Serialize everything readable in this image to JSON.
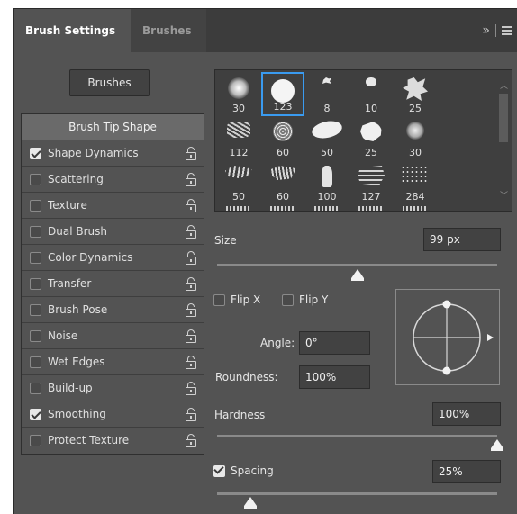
{
  "tabs": [
    {
      "label": "Brush Settings",
      "active": true
    },
    {
      "label": "Brushes",
      "active": false
    }
  ],
  "tabbar_icons": [
    "expand-icon",
    "menu-icon"
  ],
  "tabbar_expand_glyph": "»",
  "brushes_button": "Brushes",
  "list": {
    "header": "Brush Tip Shape",
    "items": [
      {
        "label": "Shape Dynamics",
        "checked": true
      },
      {
        "label": "Scattering",
        "checked": false
      },
      {
        "label": "Texture",
        "checked": false
      },
      {
        "label": "Dual Brush",
        "checked": false
      },
      {
        "label": "Color Dynamics",
        "checked": false
      },
      {
        "label": "Transfer",
        "checked": false
      },
      {
        "label": "Brush Pose",
        "checked": false
      },
      {
        "label": "Noise",
        "checked": false
      },
      {
        "label": "Wet Edges",
        "checked": false
      },
      {
        "label": "Build-up",
        "checked": false
      },
      {
        "label": "Smoothing",
        "checked": true
      },
      {
        "label": "Protect Texture",
        "checked": false
      }
    ]
  },
  "presets": [
    {
      "size": "30",
      "selected": false
    },
    {
      "size": "123",
      "selected": true
    },
    {
      "size": "8",
      "selected": false
    },
    {
      "size": "10",
      "selected": false
    },
    {
      "size": "25",
      "selected": false
    },
    {
      "size": "112",
      "selected": false
    },
    {
      "size": "60",
      "selected": false
    },
    {
      "size": "50",
      "selected": false
    },
    {
      "size": "25",
      "selected": false
    },
    {
      "size": "30",
      "selected": false
    },
    {
      "size": "50",
      "selected": false
    },
    {
      "size": "60",
      "selected": false
    },
    {
      "size": "100",
      "selected": false
    },
    {
      "size": "127",
      "selected": false
    },
    {
      "size": "284",
      "selected": false
    }
  ],
  "size": {
    "label": "Size",
    "value": "99 px",
    "slider_fraction": 0.5
  },
  "flip_x": {
    "label": "Flip X",
    "checked": false
  },
  "flip_y": {
    "label": "Flip Y",
    "checked": false
  },
  "angle": {
    "label": "Angle:",
    "value": "0°"
  },
  "roundness": {
    "label": "Roundness:",
    "value": "100%"
  },
  "hardness": {
    "label": "Hardness",
    "value": "100%",
    "slider_fraction": 1.0
  },
  "spacing": {
    "label": "Spacing",
    "checked": true,
    "value": "25%",
    "slider_fraction": 0.12
  },
  "colors": {
    "panel": "#535353",
    "tabbar": "#3c3c3c",
    "selection": "#3a9bf0"
  }
}
